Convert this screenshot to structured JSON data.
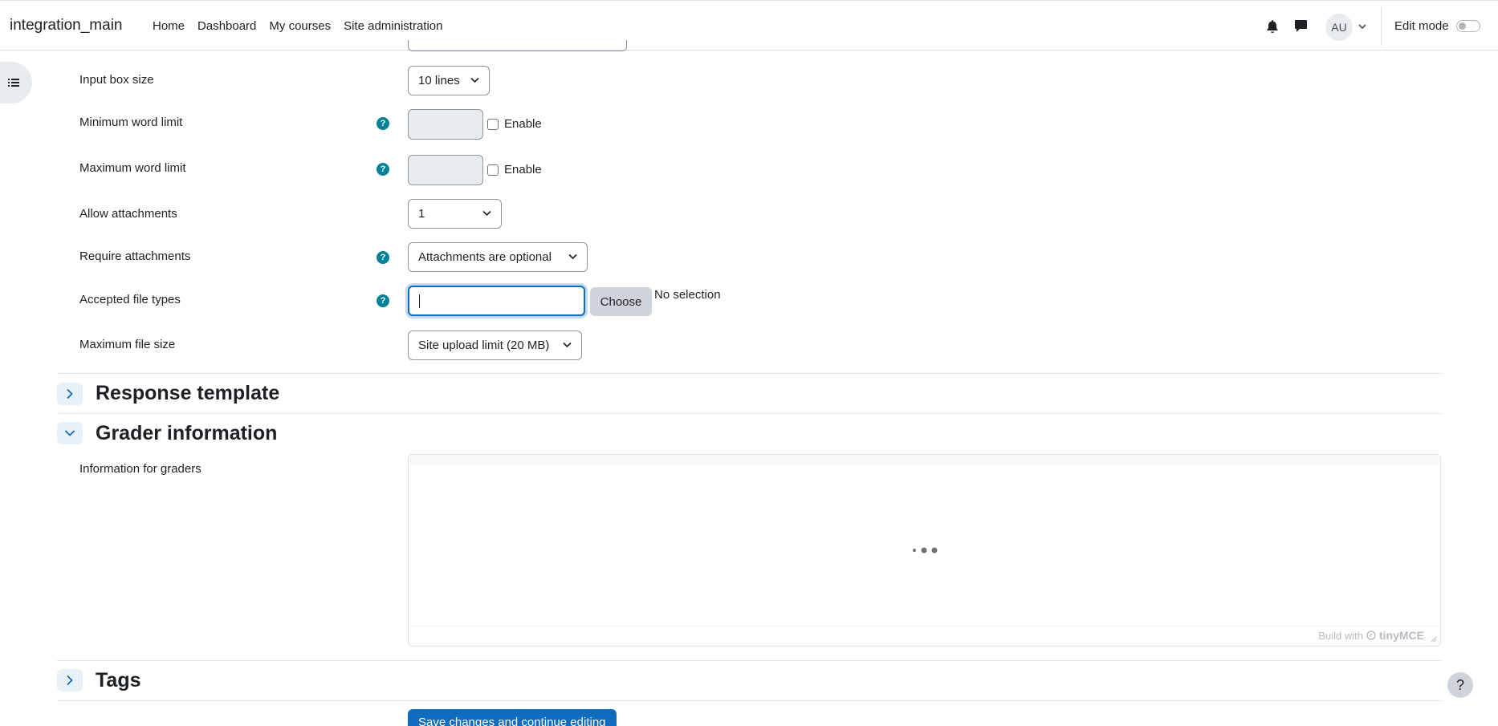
{
  "navbar": {
    "brand": "integration_main",
    "links": [
      "Home",
      "Dashboard",
      "My courses",
      "Site administration"
    ],
    "avatar_initials": "AU",
    "edit_mode_label": "Edit mode",
    "edit_mode_on": false
  },
  "form": {
    "input_box_size": {
      "label": "Input box size",
      "value": "10 lines"
    },
    "min_word_limit": {
      "label": "Minimum word limit",
      "value": "",
      "enable_label": "Enable",
      "enabled": false
    },
    "max_word_limit": {
      "label": "Maximum word limit",
      "value": "",
      "enable_label": "Enable",
      "enabled": false
    },
    "allow_attachments": {
      "label": "Allow attachments",
      "value": "1"
    },
    "require_attachments": {
      "label": "Require attachments",
      "value": "Attachments are optional"
    },
    "accepted_file_types": {
      "label": "Accepted file types",
      "value": "",
      "choose_label": "Choose",
      "selection_text": "No selection"
    },
    "max_file_size": {
      "label": "Maximum file size",
      "value": "Site upload limit (20 MB)"
    }
  },
  "sections": {
    "response_template": {
      "title": "Response template",
      "expanded": false
    },
    "grader_information": {
      "title": "Grader information",
      "expanded": true,
      "field_label": "Information for graders"
    },
    "tags": {
      "title": "Tags",
      "expanded": false
    }
  },
  "editor": {
    "branding": "Build with",
    "brand_name": "tinyMCE"
  },
  "save_button": "Save changes and continue editing",
  "help_button": "?"
}
